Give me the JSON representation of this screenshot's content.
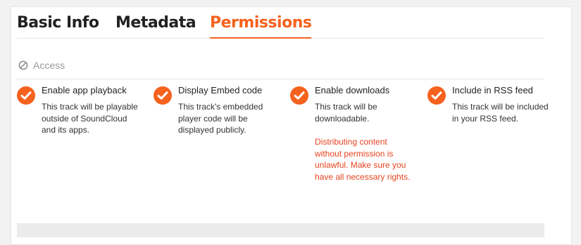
{
  "tabs": [
    {
      "label": "Basic Info",
      "active": false
    },
    {
      "label": "Metadata",
      "active": false
    },
    {
      "label": "Permissions",
      "active": true
    }
  ],
  "section": {
    "label": "Access",
    "icon": "disabled-icon"
  },
  "options": [
    {
      "title": "Enable app playback",
      "description": "This track will be playable outside of SoundCloud and its apps.",
      "checked": true
    },
    {
      "title": "Display Embed code",
      "description": "This track's embedded player code will be displayed publicly.",
      "checked": true
    },
    {
      "title": "Enable downloads",
      "description": "This track will be downloadable.",
      "warning": "Distributing content without permission is unlawful. Make sure you have all necessary rights.",
      "checked": true
    },
    {
      "title": "Include in RSS feed",
      "description": "This track will be included in your RSS feed.",
      "checked": true
    }
  ],
  "colors": {
    "accent": "#f5621e",
    "warning": "#e5431f",
    "muted": "#999999",
    "text": "#222222"
  }
}
